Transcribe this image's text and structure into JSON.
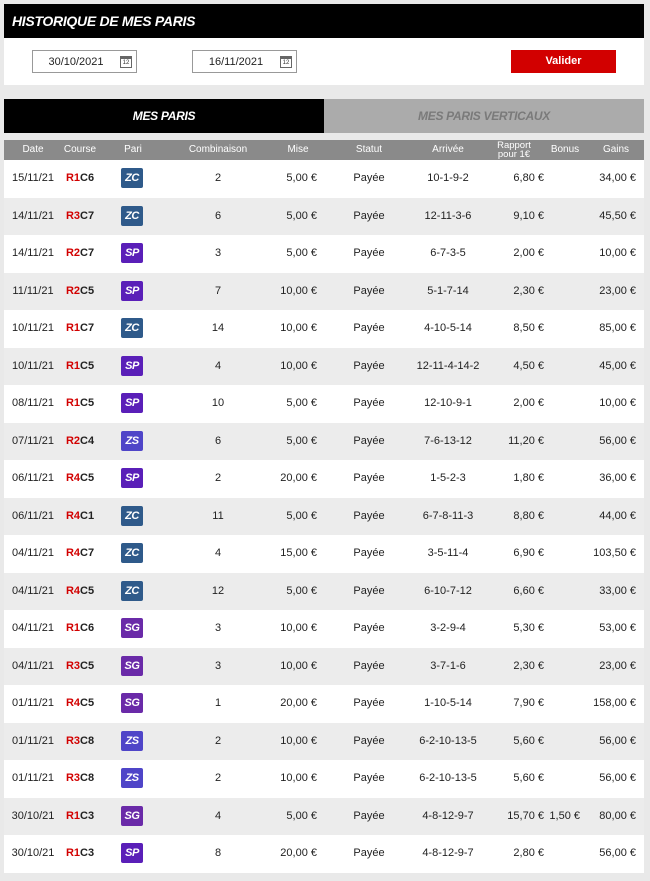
{
  "header": {
    "title": "HISTORIQUE DE MES PARIS"
  },
  "filters": {
    "date_from": "30/10/2021",
    "date_to": "16/11/2021",
    "validate_label": "Valider"
  },
  "tabs": [
    {
      "label": "MES PARIS",
      "active": true
    },
    {
      "label": "MES PARIS VERTICAUX",
      "active": false
    }
  ],
  "table": {
    "headers": {
      "date": "Date",
      "course": "Course",
      "pari": "Pari",
      "combinaison": "Combinaison",
      "mise": "Mise",
      "statut": "Statut",
      "arrivee": "Arrivée",
      "rapport_1": "Rapport",
      "rapport_2": "pour 1€",
      "bonus": "Bonus",
      "gains": "Gains"
    },
    "rows": [
      {
        "date": "15/11/21",
        "r": "R1",
        "c": "C6",
        "pari": "ZC",
        "comb": "2",
        "mise": "5,00 €",
        "statut": "Payée",
        "arrivee": "10-1-9-2",
        "rapport": "6,80 €",
        "bonus": "",
        "gains": "34,00 €"
      },
      {
        "date": "14/11/21",
        "r": "R3",
        "c": "C7",
        "pari": "ZC",
        "comb": "6",
        "mise": "5,00 €",
        "statut": "Payée",
        "arrivee": "12-11-3-6",
        "rapport": "9,10 €",
        "bonus": "",
        "gains": "45,50 €"
      },
      {
        "date": "14/11/21",
        "r": "R2",
        "c": "C7",
        "pari": "SP",
        "comb": "3",
        "mise": "5,00 €",
        "statut": "Payée",
        "arrivee": "6-7-3-5",
        "rapport": "2,00 €",
        "bonus": "",
        "gains": "10,00 €"
      },
      {
        "date": "11/11/21",
        "r": "R2",
        "c": "C5",
        "pari": "SP",
        "comb": "7",
        "mise": "10,00 €",
        "statut": "Payée",
        "arrivee": "5-1-7-14",
        "rapport": "2,30 €",
        "bonus": "",
        "gains": "23,00 €"
      },
      {
        "date": "10/11/21",
        "r": "R1",
        "c": "C7",
        "pari": "ZC",
        "comb": "14",
        "mise": "10,00 €",
        "statut": "Payée",
        "arrivee": "4-10-5-14",
        "rapport": "8,50 €",
        "bonus": "",
        "gains": "85,00 €"
      },
      {
        "date": "10/11/21",
        "r": "R1",
        "c": "C5",
        "pari": "SP",
        "comb": "4",
        "mise": "10,00 €",
        "statut": "Payée",
        "arrivee": "12-11-4-14-2",
        "rapport": "4,50 €",
        "bonus": "",
        "gains": "45,00 €"
      },
      {
        "date": "08/11/21",
        "r": "R1",
        "c": "C5",
        "pari": "SP",
        "comb": "10",
        "mise": "5,00 €",
        "statut": "Payée",
        "arrivee": "12-10-9-1",
        "rapport": "2,00 €",
        "bonus": "",
        "gains": "10,00 €"
      },
      {
        "date": "07/11/21",
        "r": "R2",
        "c": "C4",
        "pari": "ZS",
        "comb": "6",
        "mise": "5,00 €",
        "statut": "Payée",
        "arrivee": "7-6-13-12",
        "rapport": "11,20 €",
        "bonus": "",
        "gains": "56,00 €"
      },
      {
        "date": "06/11/21",
        "r": "R4",
        "c": "C5",
        "pari": "SP",
        "comb": "2",
        "mise": "20,00 €",
        "statut": "Payée",
        "arrivee": "1-5-2-3",
        "rapport": "1,80 €",
        "bonus": "",
        "gains": "36,00 €"
      },
      {
        "date": "06/11/21",
        "r": "R4",
        "c": "C1",
        "pari": "ZC",
        "comb": "11",
        "mise": "5,00 €",
        "statut": "Payée",
        "arrivee": "6-7-8-11-3",
        "rapport": "8,80 €",
        "bonus": "",
        "gains": "44,00 €"
      },
      {
        "date": "04/11/21",
        "r": "R4",
        "c": "C7",
        "pari": "ZC",
        "comb": "4",
        "mise": "15,00 €",
        "statut": "Payée",
        "arrivee": "3-5-11-4",
        "rapport": "6,90 €",
        "bonus": "",
        "gains": "103,50 €"
      },
      {
        "date": "04/11/21",
        "r": "R4",
        "c": "C5",
        "pari": "ZC",
        "comb": "12",
        "mise": "5,00 €",
        "statut": "Payée",
        "arrivee": "6-10-7-12",
        "rapport": "6,60 €",
        "bonus": "",
        "gains": "33,00 €"
      },
      {
        "date": "04/11/21",
        "r": "R1",
        "c": "C6",
        "pari": "SG",
        "comb": "3",
        "mise": "10,00 €",
        "statut": "Payée",
        "arrivee": "3-2-9-4",
        "rapport": "5,30 €",
        "bonus": "",
        "gains": "53,00 €"
      },
      {
        "date": "04/11/21",
        "r": "R3",
        "c": "C5",
        "pari": "SG",
        "comb": "3",
        "mise": "10,00 €",
        "statut": "Payée",
        "arrivee": "3-7-1-6",
        "rapport": "2,30 €",
        "bonus": "",
        "gains": "23,00 €"
      },
      {
        "date": "01/11/21",
        "r": "R4",
        "c": "C5",
        "pari": "SG",
        "comb": "1",
        "mise": "20,00 €",
        "statut": "Payée",
        "arrivee": "1-10-5-14",
        "rapport": "7,90 €",
        "bonus": "",
        "gains": "158,00 €"
      },
      {
        "date": "01/11/21",
        "r": "R3",
        "c": "C8",
        "pari": "ZS",
        "comb": "2",
        "mise": "10,00 €",
        "statut": "Payée",
        "arrivee": "6-2-10-13-5",
        "rapport": "5,60 €",
        "bonus": "",
        "gains": "56,00 €"
      },
      {
        "date": "01/11/21",
        "r": "R3",
        "c": "C8",
        "pari": "ZS",
        "comb": "2",
        "mise": "10,00 €",
        "statut": "Payée",
        "arrivee": "6-2-10-13-5",
        "rapport": "5,60 €",
        "bonus": "",
        "gains": "56,00 €"
      },
      {
        "date": "30/10/21",
        "r": "R1",
        "c": "C3",
        "pari": "SG",
        "comb": "4",
        "mise": "5,00 €",
        "statut": "Payée",
        "arrivee": "4-8-12-9-7",
        "rapport": "15,70 €",
        "bonus": "1,50 €",
        "gains": "80,00 €"
      },
      {
        "date": "30/10/21",
        "r": "R1",
        "c": "C3",
        "pari": "SP",
        "comb": "8",
        "mise": "20,00 €",
        "statut": "Payée",
        "arrivee": "4-8-12-9-7",
        "rapport": "2,80 €",
        "bonus": "",
        "gains": "56,00 €"
      }
    ]
  }
}
